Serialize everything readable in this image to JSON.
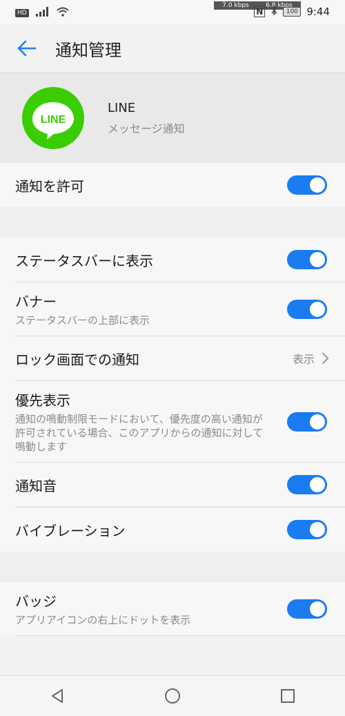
{
  "status": {
    "hd": "HD",
    "up_speed": "7.0 kbps",
    "down_speed": "6.8 kbps",
    "battery": "100",
    "time": "9:44"
  },
  "appbar": {
    "title": "通知管理"
  },
  "app": {
    "name": "LINE",
    "subtitle": "メッセージ通知",
    "icon_text": "LINE",
    "brand_color": "#3acd01"
  },
  "settings": {
    "allow": {
      "label": "通知を許可",
      "on": true
    },
    "statusbar": {
      "label": "ステータスバーに表示",
      "on": true
    },
    "banner": {
      "label": "バナー",
      "sub": "ステータスバーの上部に表示",
      "on": true
    },
    "lockscreen": {
      "label": "ロック画面での通知",
      "value": "表示"
    },
    "priority": {
      "label": "優先表示",
      "sub": "通知の鳴動制限モードにおいて、優先度の高い通知が許可されている場合、このアプリからの通知に対して鳴動します",
      "on": true
    },
    "sound": {
      "label": "通知音",
      "on": true
    },
    "vibration": {
      "label": "バイブレーション",
      "on": true
    },
    "badge": {
      "label": "バッジ",
      "sub": "アプリアイコンの右上にドットを表示",
      "on": true
    }
  },
  "accent": "#1a7cf0"
}
